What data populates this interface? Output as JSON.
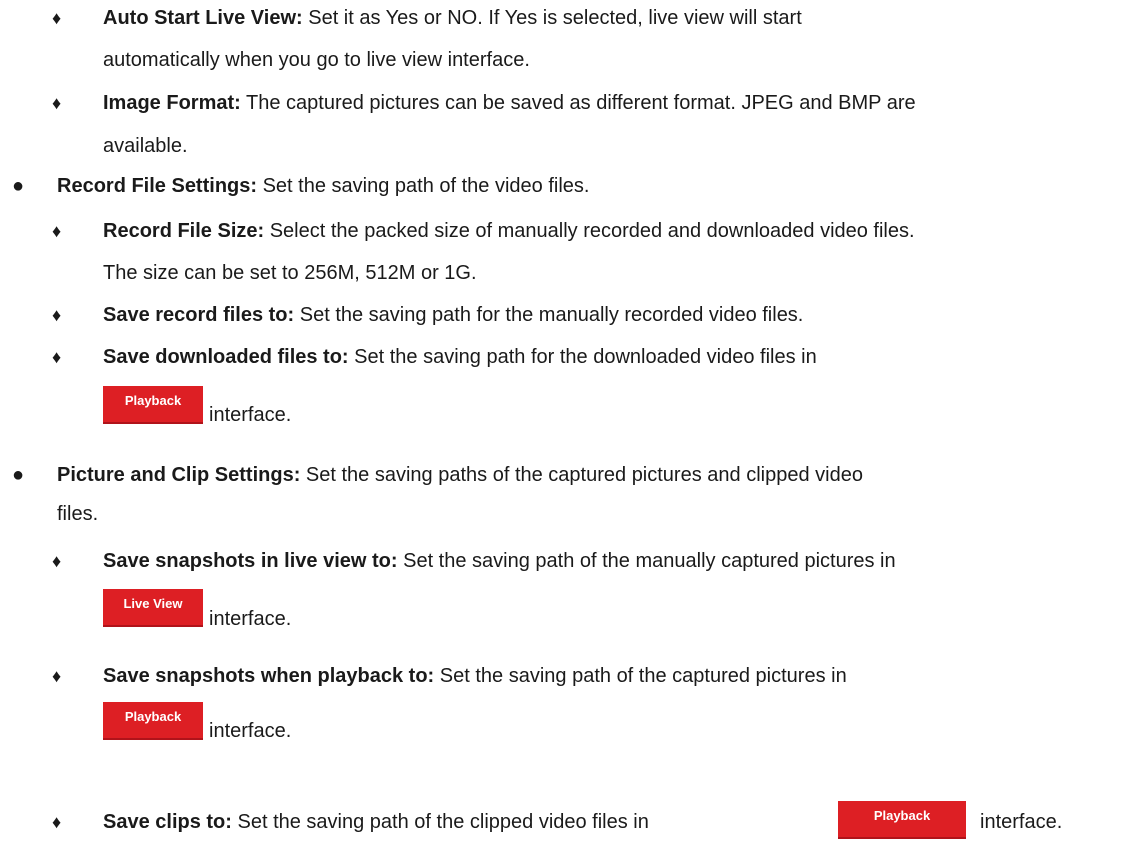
{
  "bullets": {
    "diamond": "♦",
    "dot": "●"
  },
  "items": {
    "auto_start": {
      "label": "Auto Start Live View:",
      "line1": " Set it as Yes or NO. If Yes is selected, live view will start",
      "line2": "automatically when you go to live view interface."
    },
    "image_format": {
      "label": "Image Format:",
      "line1": " The captured pictures can be saved as different format. JPEG and BMP are",
      "line2": "available."
    },
    "record_settings": {
      "label": "Record File Settings:",
      "text": " Set the saving path of the video files."
    },
    "record_size": {
      "label": "Record File Size:",
      "line1": " Select the packed size of manually recorded and downloaded video files.",
      "line2": "The size can be set to 256M, 512M or 1G."
    },
    "save_record": {
      "label": "Save record files to:",
      "text": " Set the saving path for the manually recorded video files."
    },
    "save_downloaded": {
      "label": "Save downloaded files to:",
      "line1": " Set the saving path for the downloaded video files in",
      "button": "Playback",
      "tail": "interface."
    },
    "picture_clip": {
      "label": "Picture and Clip Settings:",
      "line1": " Set the saving paths of the captured pictures and clipped video",
      "line2": "files."
    },
    "save_snap_live": {
      "label": "Save snapshots in live view to:",
      "line1": " Set the saving path of the manually captured pictures in",
      "button": "Live View",
      "tail": "interface."
    },
    "save_snap_playback": {
      "label": "Save snapshots when playback to:",
      "line1": " Set the saving path of the captured pictures in",
      "button": "Playback",
      "tail": "interface."
    },
    "save_clips": {
      "label": "Save clips to:",
      "line1": " Set the saving path of the clipped video files in",
      "button": "Playback",
      "tail": "interface."
    }
  },
  "colors": {
    "button_red": "#dd1f24",
    "text": "#1a1a1a"
  }
}
